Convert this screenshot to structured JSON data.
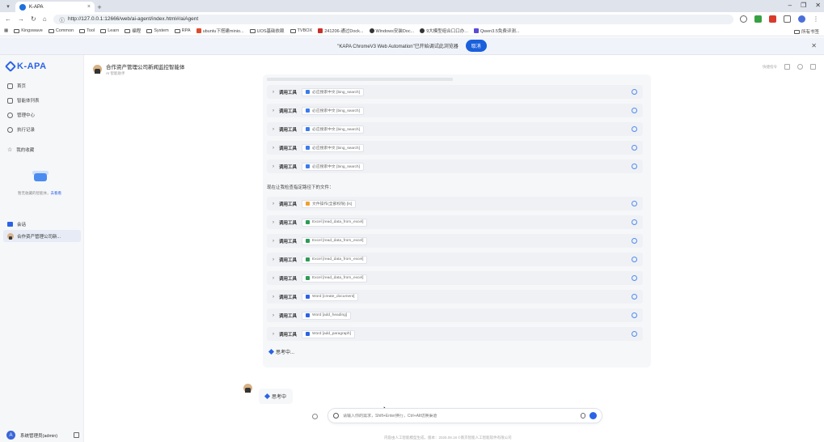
{
  "browser": {
    "tab_title": "K-APA",
    "url": "http://127.0.0.1:12666/web/ai-agent/index.html#/aiAgent",
    "bookmarks": [
      {
        "label": "Kingswave",
        "kind": "folder"
      },
      {
        "label": "Common",
        "kind": "folder"
      },
      {
        "label": "Tool",
        "kind": "folder"
      },
      {
        "label": "Learn",
        "kind": "folder"
      },
      {
        "label": "编程",
        "kind": "folder"
      },
      {
        "label": "System",
        "kind": "folder"
      },
      {
        "label": "RPA",
        "kind": "folder"
      },
      {
        "label": "ubuntu下搭建minio...",
        "kind": "site"
      },
      {
        "label": "UOS基础依赖",
        "kind": "folder"
      },
      {
        "label": "TVBOX",
        "kind": "folder"
      },
      {
        "label": "241206-通过Dock...",
        "kind": "site"
      },
      {
        "label": "Windows安装Doc...",
        "kind": "site"
      },
      {
        "label": "9大模型组合口口办...",
        "kind": "site"
      },
      {
        "label": "Qwen3.5免费评测...",
        "kind": "site"
      }
    ],
    "bookmarks_right": "所有书签",
    "infobar_message": "\"KAPA ChromeV3 Web Automation\"已开始调试此浏览器",
    "infobar_cancel": "取消"
  },
  "sidebar": {
    "logo": "K-APA",
    "nav": [
      {
        "label": "首页",
        "icon": "home-icon"
      },
      {
        "label": "智能体列表",
        "icon": "grid-icon"
      },
      {
        "label": "管理中心",
        "icon": "gear-icon"
      },
      {
        "label": "执行记录",
        "icon": "clock-icon"
      }
    ],
    "favorites_title": "我的收藏",
    "favorites_empty": "暂无收藏的智能体，",
    "favorites_link": "去看看",
    "session_title": "会话",
    "active_session": "合作资产管理公司新...",
    "user": "系统管理员(admin)",
    "user_initial": "A"
  },
  "main": {
    "agent_title": "合作资产管理公司新闻监控智能体",
    "agent_subtitle": "AI 智能助手",
    "header_action": "快捷指令",
    "tool_call_label": "调用工具",
    "tool_rows_group1": [
      {
        "chip": "必应搜索中文 [bing_search]",
        "color": "#3b7bea"
      },
      {
        "chip": "必应搜索中文 [bing_search]",
        "color": "#3b7bea"
      },
      {
        "chip": "必应搜索中文 [bing_search]",
        "color": "#3b7bea"
      },
      {
        "chip": "必应搜索中文 [bing_search]",
        "color": "#3b7bea"
      },
      {
        "chip": "必应搜索中文 [bing_search]",
        "color": "#3b7bea"
      }
    ],
    "section_text": "现在让我检查指定路径下的文件：",
    "tool_rows_group2": [
      {
        "chip": "文件操作(全部权限) [ls]",
        "color": "#f0a030"
      },
      {
        "chip": "Excel [read_data_from_excel]",
        "color": "#2e9a55"
      },
      {
        "chip": "Excel [read_data_from_excel]",
        "color": "#2e9a55"
      },
      {
        "chip": "Excel [read_data_from_excel]",
        "color": "#2e9a55"
      },
      {
        "chip": "Excel [read_data_from_excel]",
        "color": "#2e9a55"
      },
      {
        "chip": "Word [create_document]",
        "color": "#2b63e6"
      },
      {
        "chip": "Word [add_heading]",
        "color": "#2b63e6"
      },
      {
        "chip": "Word [add_paragraph]",
        "color": "#2b63e6"
      }
    ],
    "thinking_label": "思考中",
    "thinking_label_2": "思考中...",
    "input_placeholder": "请输入你的需求，Shift+Enter换行，Ctrl+Alt切换渠道",
    "footer": "内容由人工智能模型生成，版本：2025.09.18 ©南京智能人工智能软件有限公司"
  }
}
